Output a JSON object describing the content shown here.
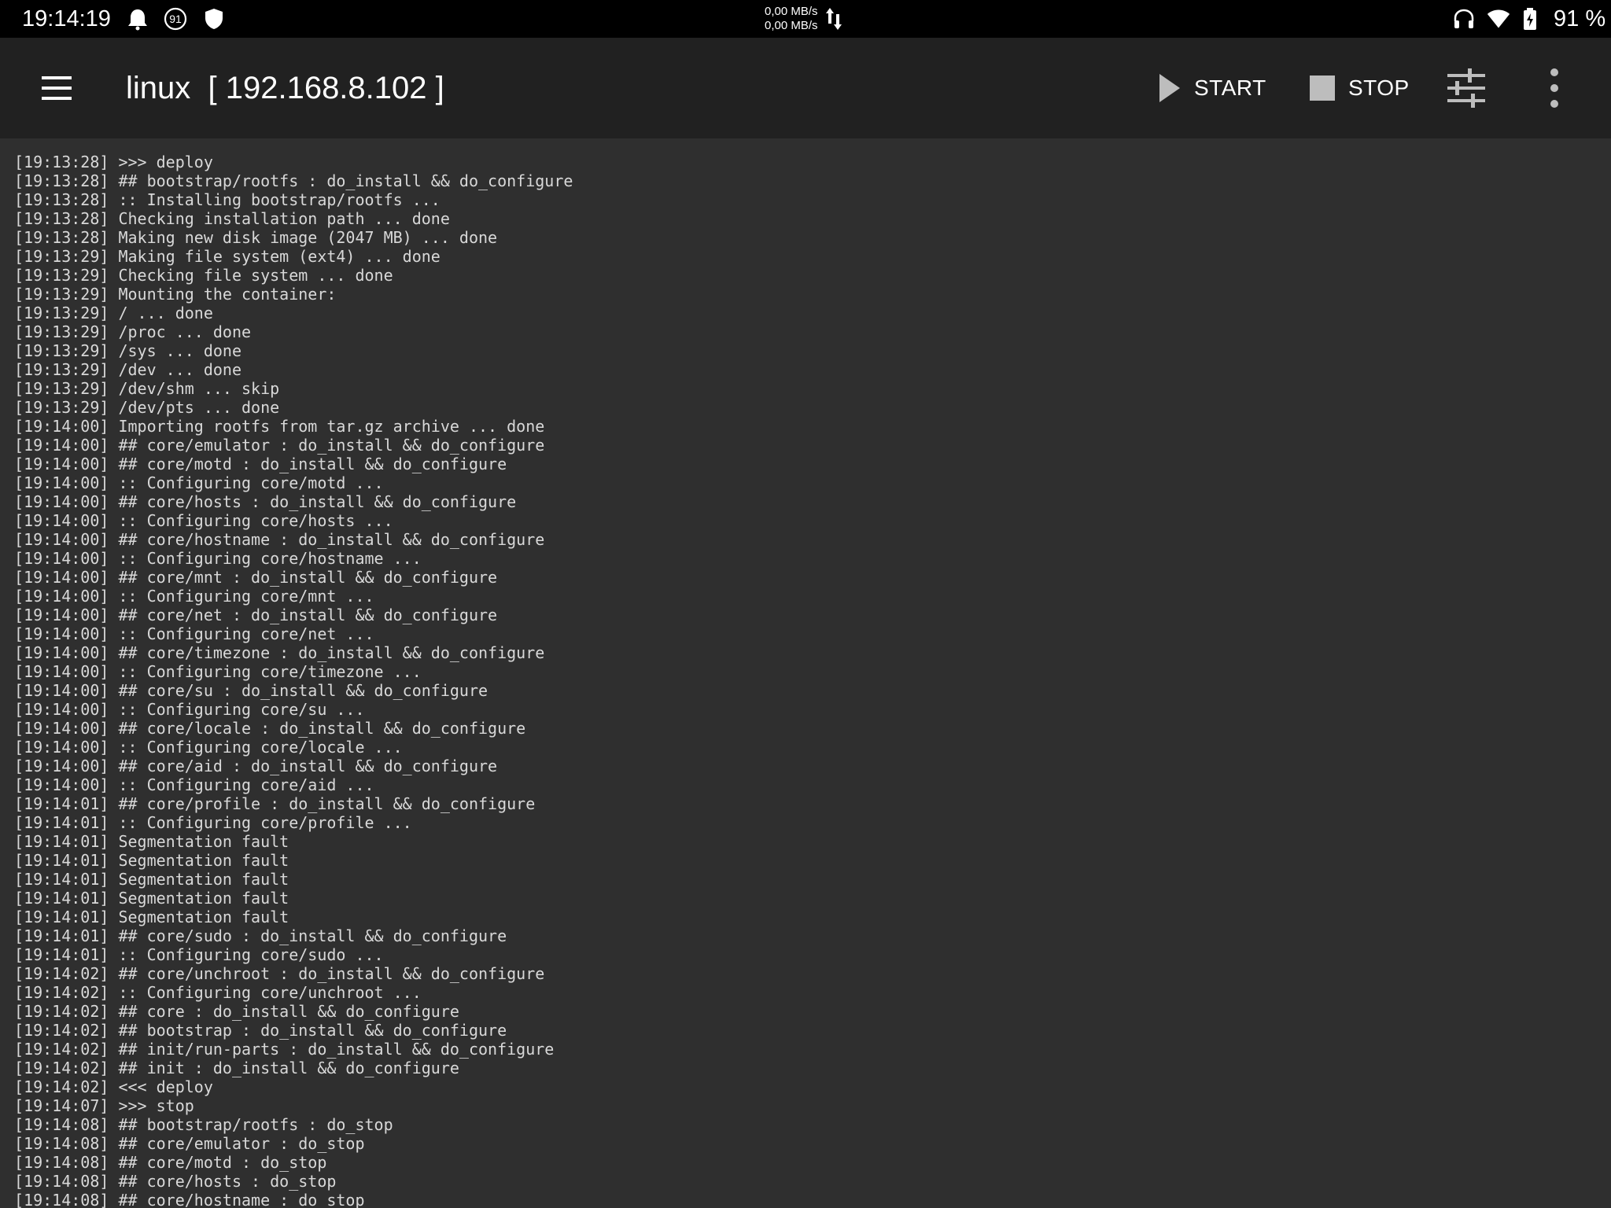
{
  "status_bar": {
    "time": "19:14:19",
    "notification_badge": "91",
    "net_up": "0,00 MB/s",
    "net_down": "0,00 MB/s",
    "battery": "91 %",
    "icons": [
      "ghost-icon",
      "badge-91-icon",
      "shield-icon",
      "headphones-icon",
      "wifi-icon",
      "battery-icon"
    ]
  },
  "toolbar": {
    "title": "linux  [ 192.168.8.102 ]",
    "start_label": "START",
    "stop_label": "STOP",
    "icons": [
      "menu-icon",
      "play-icon",
      "stop-square-icon",
      "settings-sliders-icon",
      "more-vertical-icon"
    ]
  },
  "log": {
    "lines": [
      "[19:13:28] >>> deploy",
      "[19:13:28] ## bootstrap/rootfs : do_install && do_configure",
      "[19:13:28] :: Installing bootstrap/rootfs ...",
      "[19:13:28] Checking installation path ... done",
      "[19:13:28] Making new disk image (2047 MB) ... done",
      "[19:13:29] Making file system (ext4) ... done",
      "[19:13:29] Checking file system ... done",
      "[19:13:29] Mounting the container:",
      "[19:13:29] / ... done",
      "[19:13:29] /proc ... done",
      "[19:13:29] /sys ... done",
      "[19:13:29] /dev ... done",
      "[19:13:29] /dev/shm ... skip",
      "[19:13:29] /dev/pts ... done",
      "[19:14:00] Importing rootfs from tar.gz archive ... done",
      "[19:14:00] ## core/emulator : do_install && do_configure",
      "[19:14:00] ## core/motd : do_install && do_configure",
      "[19:14:00] :: Configuring core/motd ...",
      "[19:14:00] ## core/hosts : do_install && do_configure",
      "[19:14:00] :: Configuring core/hosts ...",
      "[19:14:00] ## core/hostname : do_install && do_configure",
      "[19:14:00] :: Configuring core/hostname ...",
      "[19:14:00] ## core/mnt : do_install && do_configure",
      "[19:14:00] :: Configuring core/mnt ...",
      "[19:14:00] ## core/net : do_install && do_configure",
      "[19:14:00] :: Configuring core/net ...",
      "[19:14:00] ## core/timezone : do_install && do_configure",
      "[19:14:00] :: Configuring core/timezone ...",
      "[19:14:00] ## core/su : do_install && do_configure",
      "[19:14:00] :: Configuring core/su ...",
      "[19:14:00] ## core/locale : do_install && do_configure",
      "[19:14:00] :: Configuring core/locale ...",
      "[19:14:00] ## core/aid : do_install && do_configure",
      "[19:14:00] :: Configuring core/aid ...",
      "[19:14:01] ## core/profile : do_install && do_configure",
      "[19:14:01] :: Configuring core/profile ...",
      "[19:14:01] Segmentation fault",
      "[19:14:01] Segmentation fault",
      "[19:14:01] Segmentation fault",
      "[19:14:01] Segmentation fault",
      "[19:14:01] Segmentation fault",
      "[19:14:01] ## core/sudo : do_install && do_configure",
      "[19:14:01] :: Configuring core/sudo ...",
      "[19:14:02] ## core/unchroot : do_install && do_configure",
      "[19:14:02] :: Configuring core/unchroot ...",
      "[19:14:02] ## core : do_install && do_configure",
      "[19:14:02] ## bootstrap : do_install && do_configure",
      "[19:14:02] ## init/run-parts : do_install && do_configure",
      "[19:14:02] ## init : do_install && do_configure",
      "[19:14:02] <<< deploy",
      "[19:14:07] >>> stop",
      "[19:14:08] ## bootstrap/rootfs : do_stop",
      "[19:14:08] ## core/emulator : do_stop",
      "[19:14:08] ## core/motd : do_stop",
      "[19:14:08] ## core/hosts : do_stop",
      "[19:14:08] ## core/hostname : do_stop"
    ]
  },
  "colors": {
    "status_bar_bg": "#000000",
    "toolbar_bg": "#212121",
    "log_bg": "#2f2f2f",
    "log_text": "#d8d8d8",
    "icon_gray": "#bdbdbd"
  }
}
